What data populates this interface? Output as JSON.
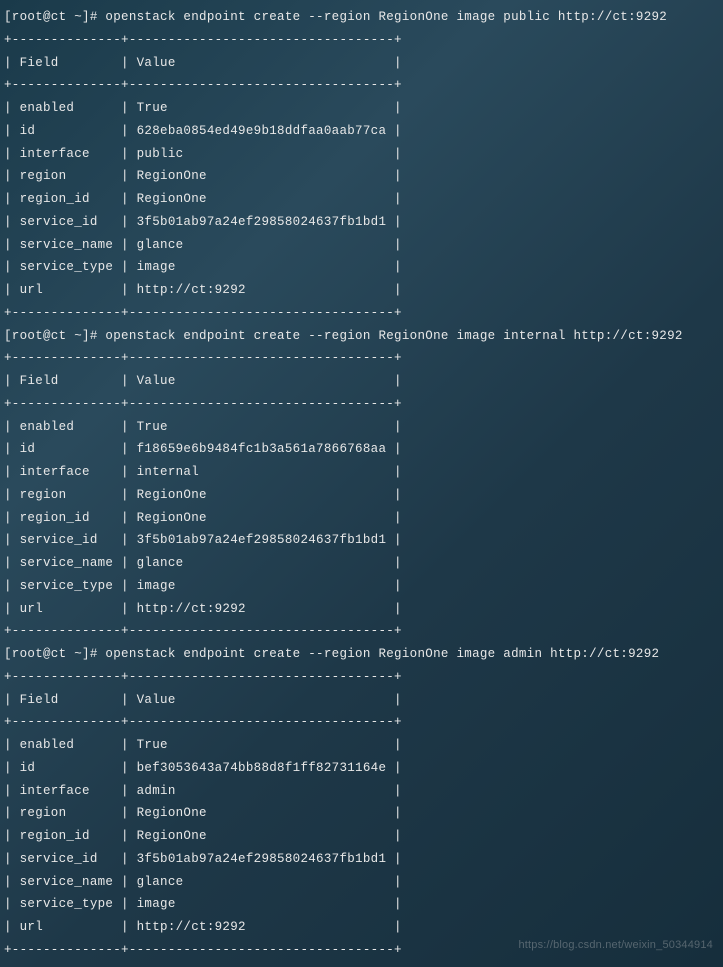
{
  "blocks": [
    {
      "prompt": "[root@ct ~]# ",
      "command": "openstack endpoint create --region RegionOne image public http://ct:9292",
      "header": {
        "field": "Field",
        "value": "Value"
      },
      "rows": [
        {
          "field": "enabled",
          "value": "True"
        },
        {
          "field": "id",
          "value": "628eba0854ed49e9b18ddfaa0aab77ca"
        },
        {
          "field": "interface",
          "value": "public"
        },
        {
          "field": "region",
          "value": "RegionOne"
        },
        {
          "field": "region_id",
          "value": "RegionOne"
        },
        {
          "field": "service_id",
          "value": "3f5b01ab97a24ef29858024637fb1bd1"
        },
        {
          "field": "service_name",
          "value": "glance"
        },
        {
          "field": "service_type",
          "value": "image"
        },
        {
          "field": "url",
          "value": "http://ct:9292"
        }
      ]
    },
    {
      "prompt": "[root@ct ~]# ",
      "command": "openstack endpoint create --region RegionOne image internal http://ct:9292",
      "header": {
        "field": "Field",
        "value": "Value"
      },
      "rows": [
        {
          "field": "enabled",
          "value": "True"
        },
        {
          "field": "id",
          "value": "f18659e6b9484fc1b3a561a7866768aa"
        },
        {
          "field": "interface",
          "value": "internal"
        },
        {
          "field": "region",
          "value": "RegionOne"
        },
        {
          "field": "region_id",
          "value": "RegionOne"
        },
        {
          "field": "service_id",
          "value": "3f5b01ab97a24ef29858024637fb1bd1"
        },
        {
          "field": "service_name",
          "value": "glance"
        },
        {
          "field": "service_type",
          "value": "image"
        },
        {
          "field": "url",
          "value": "http://ct:9292"
        }
      ]
    },
    {
      "prompt": "[root@ct ~]# ",
      "command": "openstack endpoint create --region RegionOne image admin http://ct:9292",
      "header": {
        "field": "Field",
        "value": "Value"
      },
      "rows": [
        {
          "field": "enabled",
          "value": "True"
        },
        {
          "field": "id",
          "value": "bef3053643a74bb88d8f1ff82731164e"
        },
        {
          "field": "interface",
          "value": "admin"
        },
        {
          "field": "region",
          "value": "RegionOne"
        },
        {
          "field": "region_id",
          "value": "RegionOne"
        },
        {
          "field": "service_id",
          "value": "3f5b01ab97a24ef29858024637fb1bd1"
        },
        {
          "field": "service_name",
          "value": "glance"
        },
        {
          "field": "service_type",
          "value": "image"
        },
        {
          "field": "url",
          "value": "http://ct:9292"
        }
      ]
    }
  ],
  "table_layout": {
    "field_width": 12,
    "value_width": 32,
    "divider": "+--------------+----------------------------------+"
  },
  "watermark": "https://blog.csdn.net/weixin_50344914"
}
